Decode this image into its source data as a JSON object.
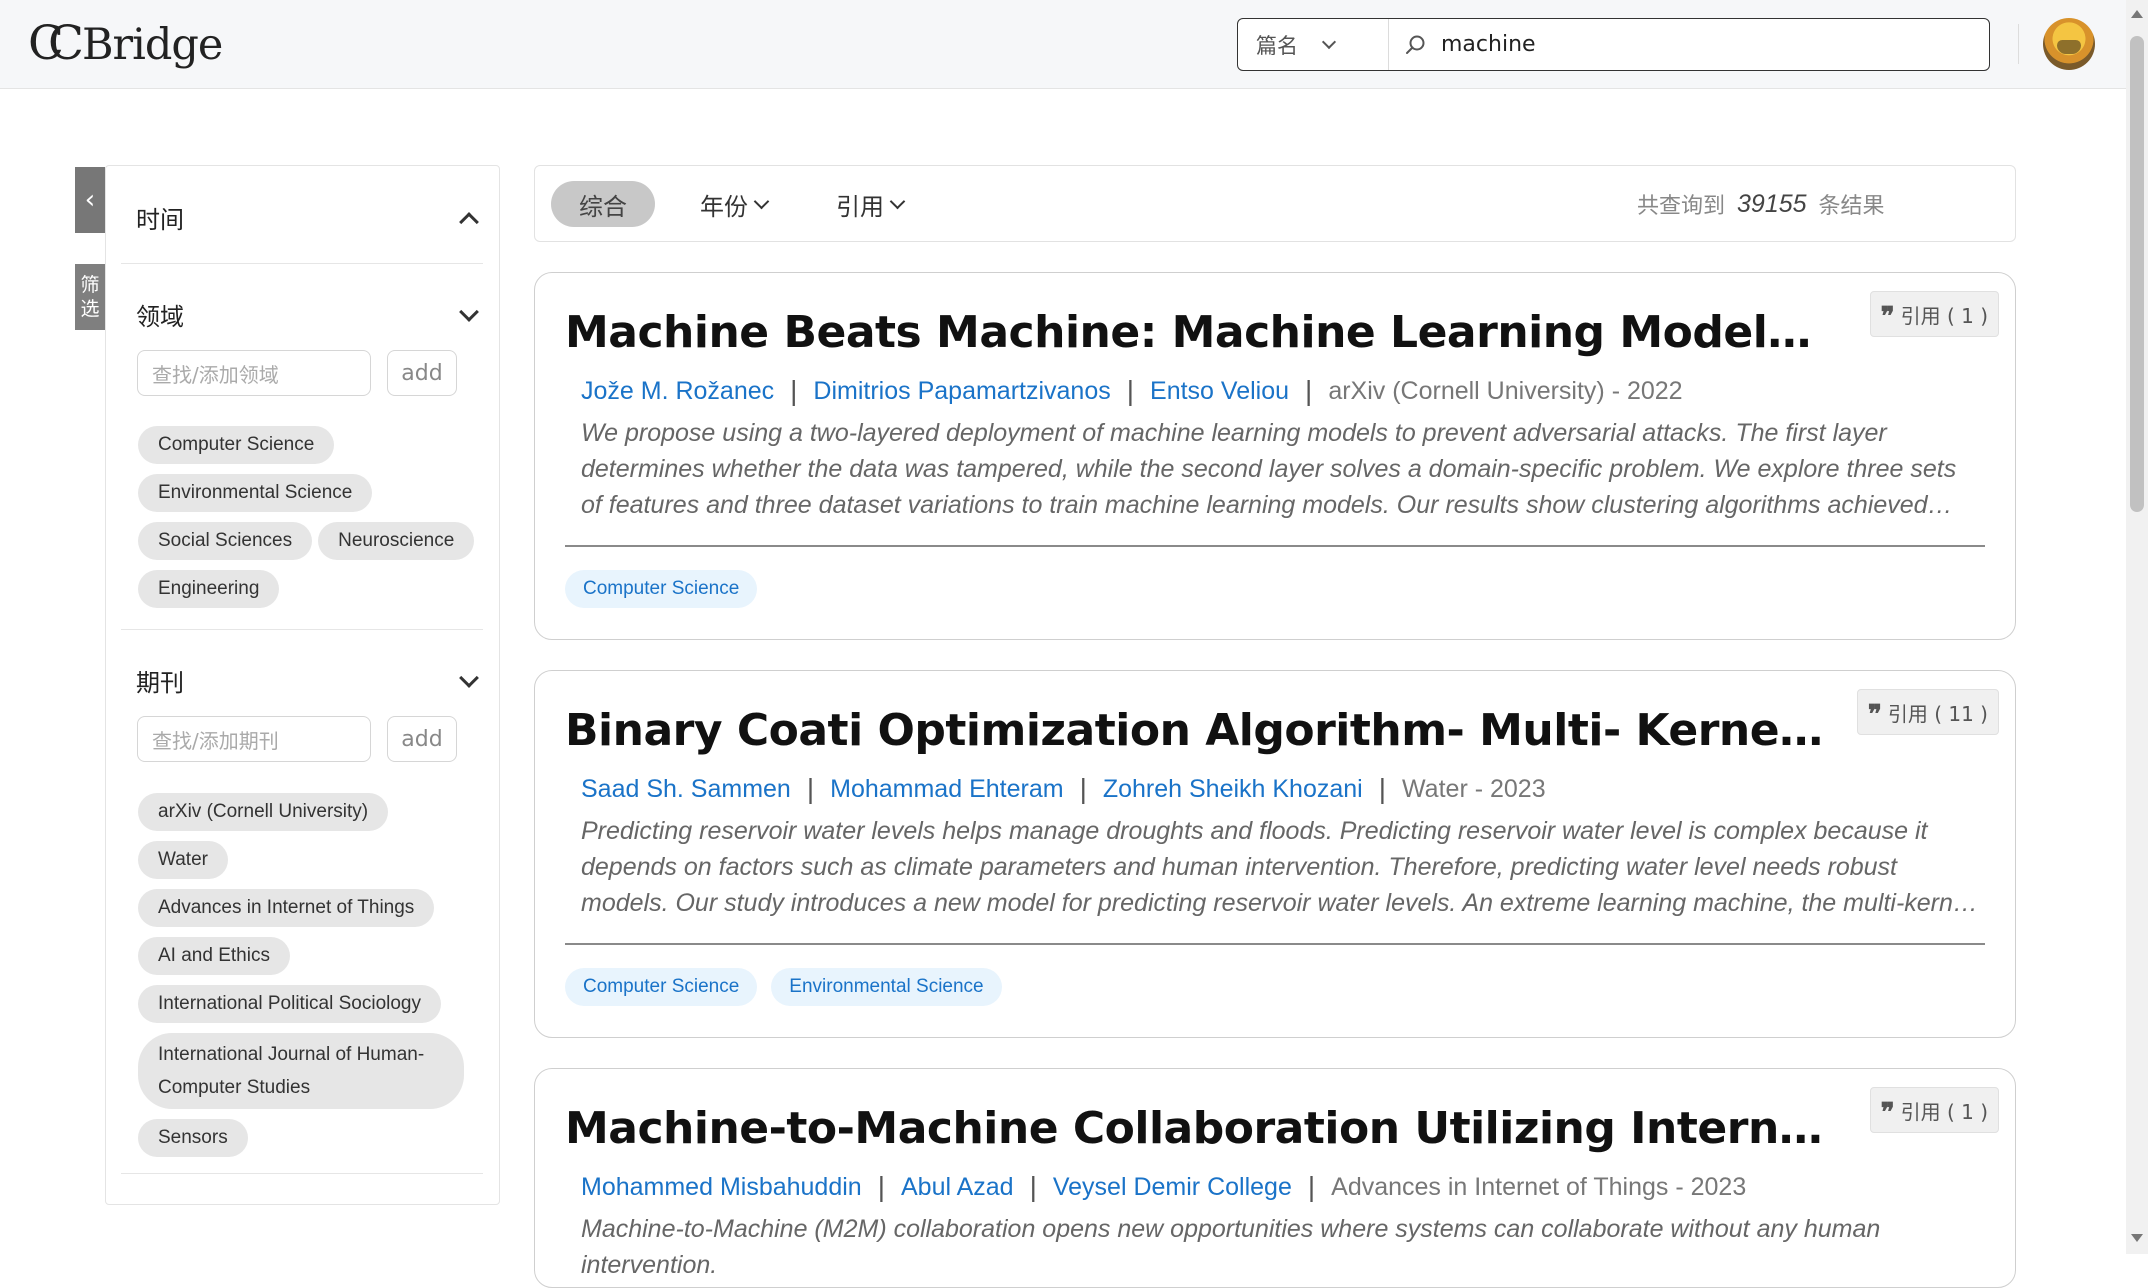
{
  "header": {
    "logo": "CCBridge",
    "search_type": "篇名",
    "search_value": "machine"
  },
  "sidebar": {
    "collapse_icon": "chevron-left-icon",
    "filter_tab": [
      "筛",
      "选"
    ],
    "time": {
      "title": "时间"
    },
    "field": {
      "title": "领域",
      "placeholder": "查找/添加领域",
      "add_label": "add",
      "chips": [
        "Computer Science",
        "Environmental Science",
        "Social Sciences",
        "Neuroscience",
        "Engineering"
      ]
    },
    "journal": {
      "title": "期刊",
      "placeholder": "查找/添加期刊",
      "add_label": "add",
      "chips": [
        "arXiv (Cornell University)",
        "Water",
        "Advances in Internet of Things",
        "AI and Ethics",
        "International Political Sociology",
        "International Journal of Human-Computer Studies",
        "Sensors"
      ]
    }
  },
  "sortbar": {
    "active": "综合",
    "year": "年份",
    "citation": "引用",
    "count_prefix": "共查询到",
    "count": "39155",
    "count_suffix": "条结果"
  },
  "results": [
    {
      "title": "Machine Beats Machine: Machine Learning Models to Defend Against Adversarial Attacks",
      "cite": "引用 ( 1 )",
      "authors": [
        "Jože M. Rožanec",
        "Dimitrios Papamartzivanos",
        "Entso Veliou"
      ],
      "venue": "arXiv (Cornell University) - 2022",
      "abstract": "We propose using a two-layered deployment of machine learning models to prevent adversarial attacks. The first layer determines whether the data was tampered, while the second layer solves a domain-specific problem. We explore three sets of features and three dataset variations to train machine learning models. Our results show clustering algorithms achieved promising results.",
      "tags": [
        "Computer Science"
      ]
    },
    {
      "title": "Binary Coati Optimization Algorithm- Multi- Kernel Least Square Support Vector Machine",
      "cite": "引用 ( 11 )",
      "authors": [
        "Saad Sh. Sammen",
        "Mohammad Ehteram",
        "Zohreh Sheikh Khozani"
      ],
      "venue": "Water - 2023",
      "abstract": "Predicting reservoir water levels helps manage droughts and floods. Predicting reservoir water level is complex because it depends on factors such as climate parameters and human intervention. Therefore, predicting water level needs robust models. Our study introduces a new model for predicting reservoir water levels. An extreme learning machine, the multi-kernel model is proposed.",
      "tags": [
        "Computer Science",
        "Environmental Science"
      ]
    },
    {
      "title": "Machine-to-Machine Collaboration Utilizing Internet of Things and Machine Learning",
      "cite": "引用 ( 1 )",
      "authors": [
        "Mohammed Misbahuddin",
        "Abul Azad",
        "Veysel Demir College"
      ],
      "venue": "Advances in Internet of Things - 2023",
      "abstract": "Machine-to-Machine (M2M) collaboration opens new opportunities where systems can collaborate without any human intervention.",
      "tags": []
    }
  ]
}
